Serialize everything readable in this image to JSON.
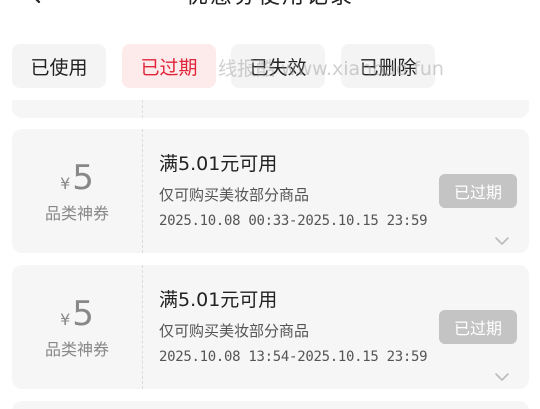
{
  "header": {
    "title": "优惠券使用记录"
  },
  "tabs": [
    {
      "label": "已使用",
      "active": false
    },
    {
      "label": "已过期",
      "active": true
    },
    {
      "label": "已失效",
      "active": false
    },
    {
      "label": "已删除",
      "active": false
    }
  ],
  "watermark": "线报酷 www.xianbao.fun",
  "coupons": [
    {
      "currency": "¥",
      "amount": "5",
      "type": "品类神券",
      "title": "满5.01元可用",
      "desc": "仅可购买美妆部分商品",
      "time": "2025.10.08 00:33-2025.10.15 23:59",
      "status": "已过期"
    },
    {
      "currency": "¥",
      "amount": "5",
      "type": "品类神券",
      "title": "满5.01元可用",
      "desc": "仅可购买美妆部分商品",
      "time": "2025.10.08 13:54-2025.10.15 23:59",
      "status": "已过期"
    }
  ],
  "colors": {
    "accent": "#e0243a",
    "active_tab_bg": "#fdeaea",
    "card_bg": "#f6f6f6",
    "status_bg": "#c4c4c4"
  }
}
